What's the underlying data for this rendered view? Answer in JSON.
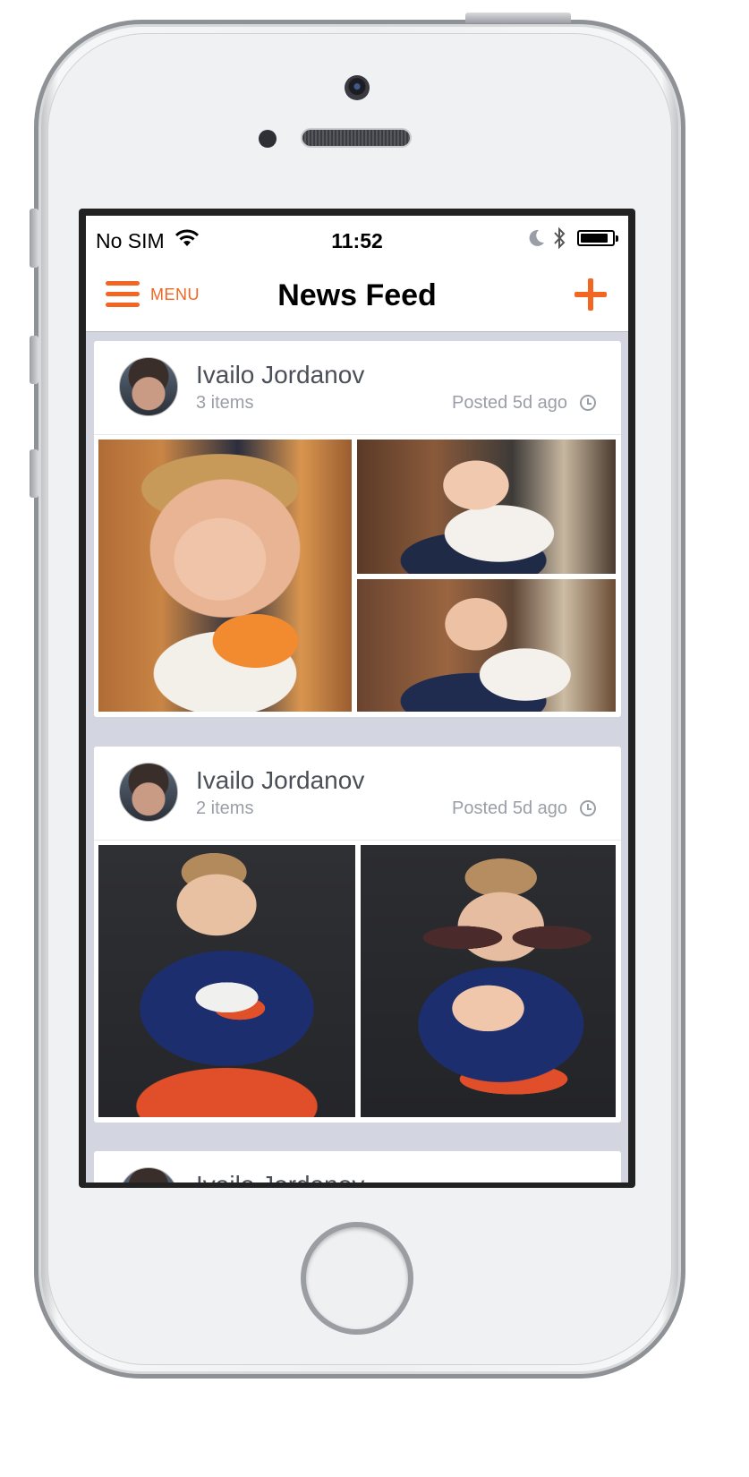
{
  "status_bar": {
    "carrier": "No SIM",
    "time": "11:52",
    "icons": [
      "wifi-icon",
      "moon-icon",
      "bluetooth-icon",
      "battery-icon"
    ]
  },
  "nav": {
    "menu_label": "MENU",
    "title": "News Feed",
    "add_icon": "plus-icon",
    "accent_color": "#f26522"
  },
  "feed": {
    "posts": [
      {
        "author": "Ivailo Jordanov",
        "items": "3 items",
        "posted": "Posted 5d ago"
      },
      {
        "author": "Ivailo Jordanov",
        "items": "2 items",
        "posted": "Posted 5d ago"
      },
      {
        "author": "Ivailo Jordanov"
      }
    ]
  }
}
